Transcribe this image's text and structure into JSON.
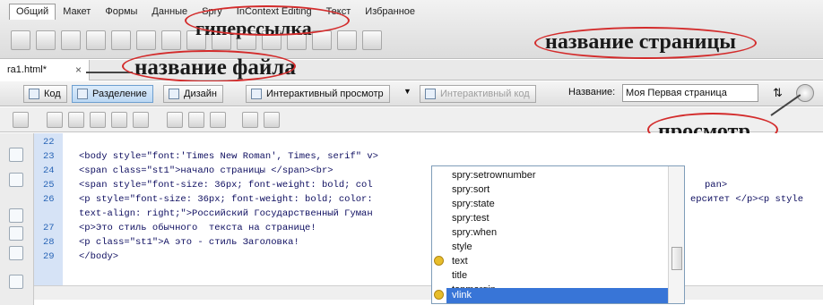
{
  "tabs": [
    "Общий",
    "Макет",
    "Формы",
    "Данные",
    "Spry",
    "InContext Editing",
    "Текст",
    "Избранное"
  ],
  "annotations": {
    "hyperlink": "гиперссылка",
    "page_title": "название страницы",
    "file_name": "название файла",
    "preview": "просмотр"
  },
  "document": {
    "file_tab": "ra1.html*",
    "close": "×"
  },
  "view_toolbar": {
    "code": "Код",
    "split": "Разделение",
    "design": "Дизайн",
    "live_view": "Интерактивный просмотр",
    "live_code": "Интерактивный код",
    "title_label": "Название:",
    "title_value": "Моя Первая страница"
  },
  "code_lines": {
    "numbers": [
      "22",
      "23",
      "24",
      "25",
      "26",
      "27",
      "28",
      "29"
    ],
    "l23": "<body style=\"font:'Times New Roman', Times, serif\" v>",
    "l24": "<span class=\"st1\">начало страницы </span><br>",
    "l25a": "<span style=\"font-size: 36px; font-weight: bold; col",
    "l25b": "pan>",
    "l26a": "<p style=\"font-size: 36px; font-weight: bold; color:",
    "l26b": "ерситет </p><p style",
    "l26c": "text-align: right;\">Российский Государственный Гуман",
    "l27": "<p>Это стиль обычного  текста на странице!",
    "l28": "<p class=\"st1\">А это - стиль Заголовка!",
    "l29": "</body>"
  },
  "hint_items": [
    "spry:setrownumber",
    "spry:sort",
    "spry:state",
    "spry:test",
    "spry:when",
    "style",
    "text",
    "title",
    "topmargin",
    "vlink"
  ],
  "colors": {
    "selected": "#3875d7",
    "annotation_outline": "#d32b2b",
    "gutter": "#d6e3f6"
  }
}
